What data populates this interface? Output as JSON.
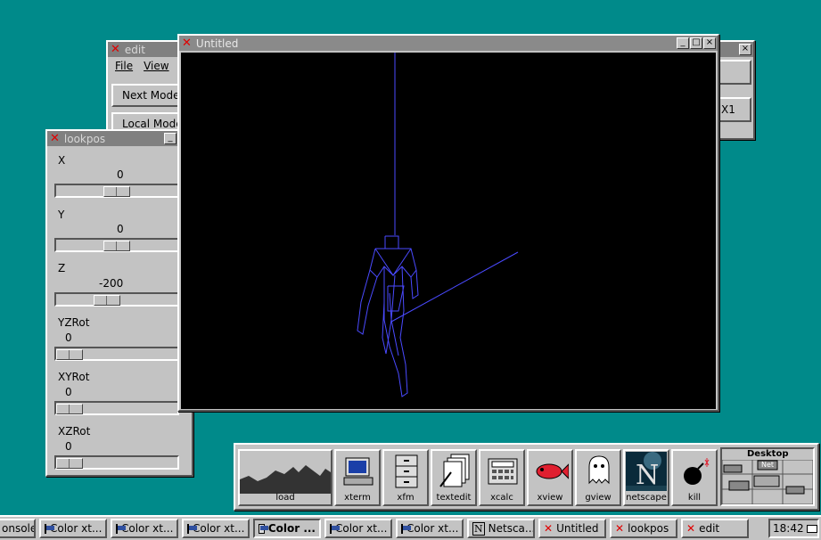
{
  "edit_window": {
    "title": "edit",
    "menu_file": "File",
    "menu_view": "View",
    "next_mode_label": "Next Mode",
    "local_mode_label": "Local Mode",
    "right_button_label": "X1"
  },
  "lookpos_window": {
    "title": "lookpos",
    "sliders": [
      {
        "label": "X",
        "value": "0",
        "level": 0.5
      },
      {
        "label": "Y",
        "value": "0",
        "level": 0.5
      },
      {
        "label": "Z",
        "value": "-200",
        "level": 0.4
      },
      {
        "label": "YZRot",
        "value": "0",
        "level": 0.0
      },
      {
        "label": "XYRot",
        "value": "0",
        "level": 0.0
      },
      {
        "label": "XZRot",
        "value": "0",
        "level": 0.0
      }
    ]
  },
  "viewer_window": {
    "title": "Untitled",
    "wireframe_color": "#4a4aff"
  },
  "launcher": {
    "items": [
      {
        "label": "load",
        "icon": "load-graph-icon"
      },
      {
        "label": "xterm",
        "icon": "xterm-monitor-icon"
      },
      {
        "label": "xfm",
        "icon": "file-cabinet-icon"
      },
      {
        "label": "textedit",
        "icon": "text-pages-icon"
      },
      {
        "label": "xcalc",
        "icon": "calculator-icon"
      },
      {
        "label": "xview",
        "icon": "fish-icon"
      },
      {
        "label": "gview",
        "icon": "ghost-icon"
      },
      {
        "label": "netscape",
        "icon": "netscape-icon"
      },
      {
        "label": "kill",
        "icon": "bomb-icon"
      }
    ],
    "desktop_label": "Desktop",
    "desktop_net_label": "Net"
  },
  "taskbar": {
    "tasks": [
      {
        "label": "onsole",
        "icon": "console-icon"
      },
      {
        "label": "Color xt...",
        "icon": "xterm-icon"
      },
      {
        "label": "Color xt...",
        "icon": "xterm-icon"
      },
      {
        "label": "Color xt...",
        "icon": "xterm-icon"
      },
      {
        "label": "Color ...",
        "icon": "xterm-icon"
      },
      {
        "label": "Color xt...",
        "icon": "xterm-icon"
      },
      {
        "label": "Color xt...",
        "icon": "xterm-icon"
      },
      {
        "label": "Netsca...",
        "icon": "netscape-icon"
      },
      {
        "label": "Untitled",
        "icon": "x-icon"
      },
      {
        "label": "lookpos",
        "icon": "x-icon"
      },
      {
        "label": "edit",
        "icon": "x-icon"
      }
    ],
    "clock": "18:42"
  },
  "colors": {
    "desktop": "#008a8a",
    "x_logo": "#e00000"
  }
}
